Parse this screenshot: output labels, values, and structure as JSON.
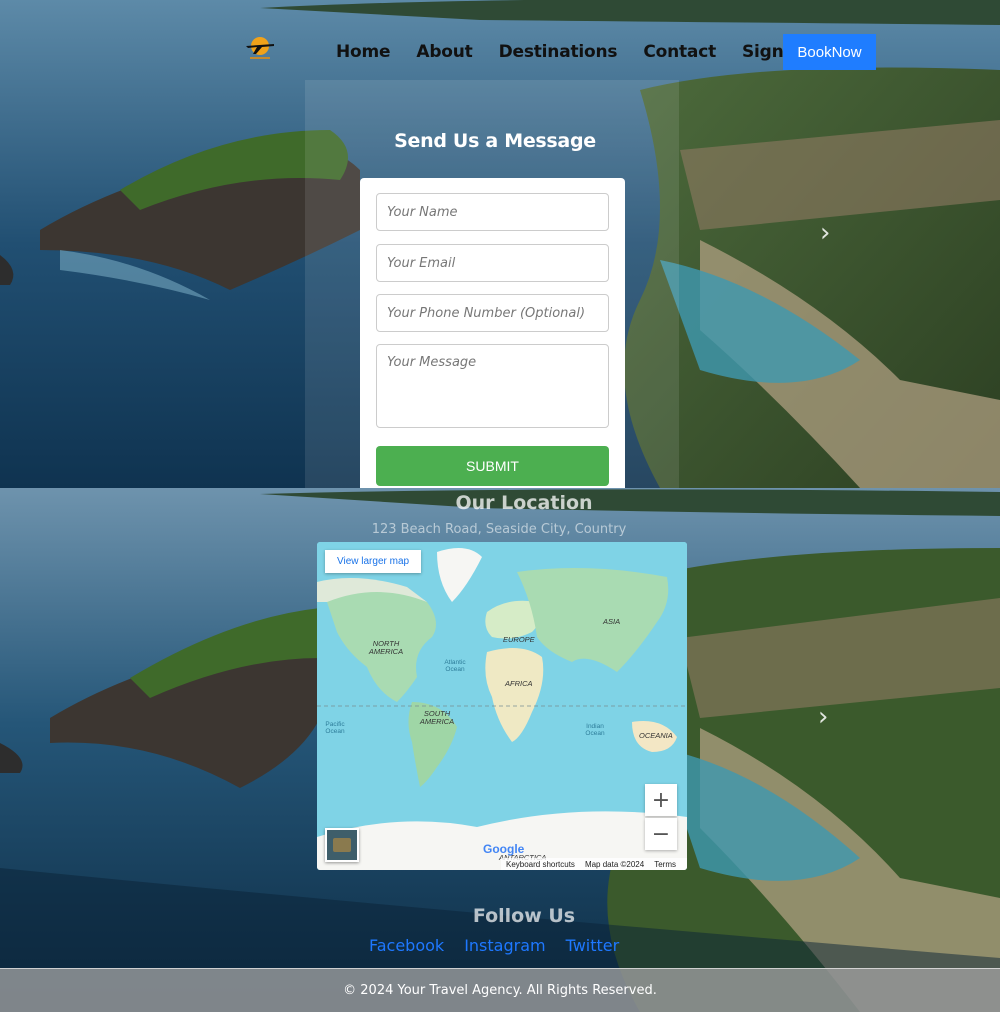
{
  "nav": {
    "items": [
      {
        "label": "Home"
      },
      {
        "label": "About"
      },
      {
        "label": "Destinations"
      },
      {
        "label": "Contact"
      },
      {
        "label": "Signup"
      }
    ],
    "book_label": "BookNow"
  },
  "contact_form": {
    "title": "Send Us a Message",
    "name_placeholder": "Your Name",
    "email_placeholder": "Your Email",
    "phone_placeholder": "Your Phone Number (Optional)",
    "message_placeholder": "Your Message",
    "submit_label": "SUBMIT"
  },
  "location": {
    "title": "Our Location",
    "address": "123 Beach Road, Seaside City, Country",
    "map": {
      "larger_map_label": "View larger map",
      "zoom_in": "+",
      "zoom_out": "−",
      "brand": "Google",
      "keyboard_shortcuts": "Keyboard shortcuts",
      "map_data": "Map data ©2024",
      "terms": "Terms",
      "labels": {
        "north_america": "NORTH AMERICA",
        "south_america": "SOUTH AMERICA",
        "europe": "EUROPE",
        "asia": "ASIA",
        "africa": "AFRICA",
        "oceania": "OCEANIA",
        "antarctica": "ANTARCTICA",
        "atlantic": "Atlantic Ocean",
        "indian": "Indian Ocean",
        "pacific": "Pacific Ocean"
      }
    }
  },
  "follow": {
    "title": "Follow Us",
    "links": [
      {
        "label": "Facebook"
      },
      {
        "label": "Instagram"
      },
      {
        "label": "Twitter"
      }
    ]
  },
  "footer": {
    "text": "© 2024 Your Travel Agency. All Rights Reserved."
  },
  "colors": {
    "accent": "#1f7dff",
    "submit": "#4caf50",
    "link": "#1e78ff"
  },
  "icons": [
    "plane-logo-icon",
    "chevron-right-icon",
    "map-layer-icon"
  ]
}
